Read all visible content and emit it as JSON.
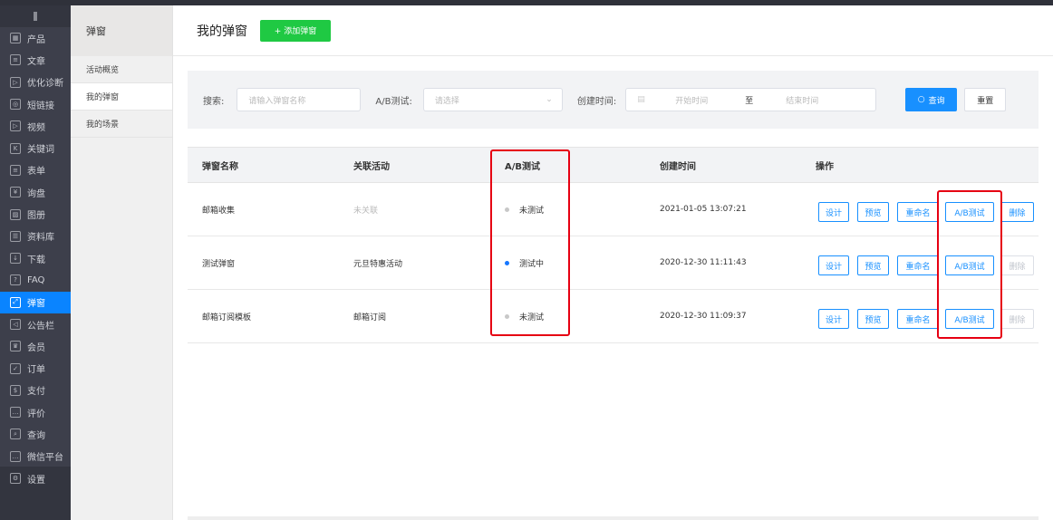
{
  "nav": {
    "items": [
      {
        "label": "产品",
        "icon": "grid-icon",
        "glyph": "▦"
      },
      {
        "label": "文章",
        "icon": "article-icon",
        "glyph": "≡"
      },
      {
        "label": "优化诊断",
        "icon": "play-circle-icon",
        "glyph": "▷"
      },
      {
        "label": "短链接",
        "icon": "link-icon",
        "glyph": "◎"
      },
      {
        "label": "视频",
        "icon": "video-icon",
        "glyph": "▷"
      },
      {
        "label": "关键词",
        "icon": "keyword-icon",
        "glyph": "K"
      },
      {
        "label": "表单",
        "icon": "form-icon",
        "glyph": "≡"
      },
      {
        "label": "询盘",
        "icon": "inquiry-icon",
        "glyph": "¥"
      },
      {
        "label": "图册",
        "icon": "album-icon",
        "glyph": "▨"
      },
      {
        "label": "资料库",
        "icon": "library-icon",
        "glyph": "☰"
      },
      {
        "label": "下载",
        "icon": "download-icon",
        "glyph": "↓"
      },
      {
        "label": "FAQ",
        "icon": "faq-icon",
        "glyph": "?"
      },
      {
        "label": "弹窗",
        "icon": "popup-icon",
        "glyph": "⤢",
        "active": true
      },
      {
        "label": "公告栏",
        "icon": "speaker-icon",
        "glyph": "◁"
      },
      {
        "label": "会员",
        "icon": "crown-icon",
        "glyph": "♛"
      },
      {
        "label": "订单",
        "icon": "order-icon",
        "glyph": "✓"
      },
      {
        "label": "支付",
        "icon": "pay-icon",
        "glyph": "$"
      },
      {
        "label": "评价",
        "icon": "comment-icon",
        "glyph": "…"
      },
      {
        "label": "查询",
        "icon": "search-icon",
        "glyph": "⌕"
      },
      {
        "label": "微信平台",
        "icon": "wechat-icon",
        "glyph": "…"
      },
      {
        "label": "设置",
        "icon": "gear-icon",
        "glyph": "⚙"
      }
    ]
  },
  "subnav": {
    "title": "弹窗",
    "items": [
      {
        "label": "活动概览"
      },
      {
        "label": "我的弹窗",
        "active": true
      },
      {
        "label": "我的场景"
      }
    ]
  },
  "header": {
    "title": "我的弹窗",
    "add_button": "+ 添加弹窗"
  },
  "filter": {
    "search_label": "搜索:",
    "search_placeholder": "请输入弹窗名称",
    "ab_label": "A/B测试:",
    "ab_placeholder": "请选择",
    "time_label": "创建时间:",
    "start_placeholder": "开始时间",
    "to": "至",
    "end_placeholder": "结束时间",
    "query_button": "查询",
    "reset_button": "重置"
  },
  "table": {
    "columns": [
      "弹窗名称",
      "关联活动",
      "A/B测试",
      "创建时间",
      "操作"
    ],
    "rows": [
      {
        "name": "邮箱收集",
        "activity": "未关联",
        "activity_muted": true,
        "ab": "未测试",
        "ab_status": "idle",
        "time": "2021-01-05 13:07:21",
        "delete_enabled": true
      },
      {
        "name": "测试弹窗",
        "activity": "元旦特惠活动",
        "ab": "测试中",
        "ab_status": "running",
        "time": "2020-12-30 11:11:43",
        "delete_enabled": false
      },
      {
        "name": "邮箱订阅模板",
        "activity": "邮箱订阅",
        "ab": "未测试",
        "ab_status": "idle",
        "time": "2020-12-30 11:09:37",
        "delete_enabled": false
      }
    ],
    "actions": [
      "设计",
      "预览",
      "重命名",
      "A/B测试",
      "删除"
    ]
  },
  "colors": {
    "accent": "#1890ff",
    "active_nav": "#0a84ff",
    "add_green": "#1fc943",
    "highlight": "#e60012",
    "running_dot": "#1677ff",
    "idle_dot": "#c8c8c8"
  }
}
